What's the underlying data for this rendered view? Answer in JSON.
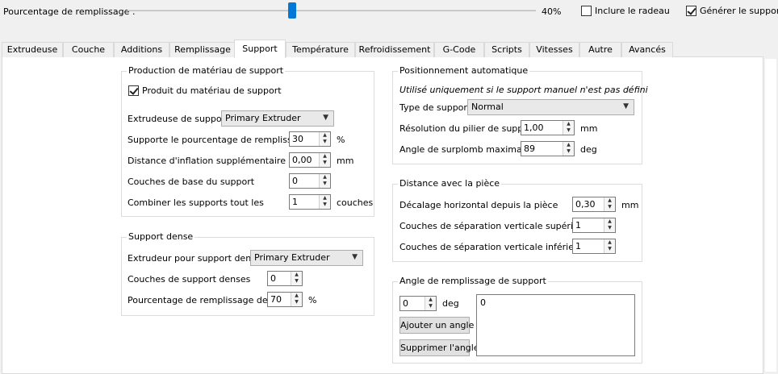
{
  "top": {
    "fill_label": "Pourcentage de remplissage :",
    "fill_value": "40%",
    "include_brim_label": "Inclure le radeau",
    "generate_support_label": "Générer le support",
    "include_brim_checked": false,
    "generate_support_checked": true
  },
  "tabs": [
    "Extrudeuse",
    "Couche",
    "Additions",
    "Remplissage",
    "Support",
    "Température",
    "Refroidissement",
    "G-Code",
    "Scripts",
    "Vitesses",
    "Autre",
    "Avancés"
  ],
  "active_tab": "Support",
  "support_material": {
    "title": "Production de matériau de support",
    "produce_label": "Produit du matériau de support",
    "produce_checked": true,
    "extruder_label": "Extrudeuse de support",
    "extruder_value": "Primary Extruder",
    "fill_pct_label": "Supporte le pourcentage de remplissage",
    "fill_pct_value": "30",
    "fill_pct_unit": "%",
    "inflation_label": "Distance d'inflation supplémentaire",
    "inflation_value": "0,00",
    "inflation_unit": "mm",
    "base_layers_label": "Couches de base du support",
    "base_layers_value": "0",
    "combine_label": "Combiner les supports tout les",
    "combine_value": "1",
    "combine_unit": "couches"
  },
  "dense_support": {
    "title": "Support dense",
    "extruder_label": "Extrudeur pour support dense",
    "extruder_value": "Primary Extruder",
    "layers_label": "Couches de support denses",
    "layers_value": "0",
    "fill_label": "Pourcentage de remplissage dense",
    "fill_value": "70",
    "fill_unit": "%"
  },
  "auto_position": {
    "title": "Positionnement automatique",
    "note": "Utilisé uniquement si le support manuel n'est pas défini",
    "type_label": "Type de support",
    "type_value": "Normal",
    "pillar_label": "Résolution du pilier de support",
    "pillar_value": "1,00",
    "pillar_unit": "mm",
    "overhang_label": "Angle de surplomb maximal",
    "overhang_value": "89",
    "overhang_unit": "deg"
  },
  "distance": {
    "title": "Distance avec la pièce",
    "xy_label": "Décalage horizontal depuis la pièce",
    "xy_value": "0,30",
    "xy_unit": "mm",
    "top_label": "Couches de séparation verticale supérieure",
    "top_value": "1",
    "bottom_label": "Couches de séparation verticale inférieure",
    "bottom_value": "1"
  },
  "infill_angle": {
    "title": "Angle de remplissage de support",
    "angle_value": "0",
    "angle_unit": "deg",
    "add_label": "Ajouter un angle",
    "remove_label": "Supprimer l'angle",
    "list": [
      "0"
    ]
  }
}
